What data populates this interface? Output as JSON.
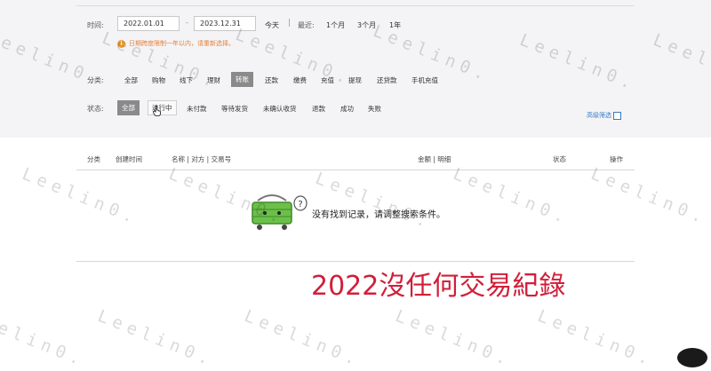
{
  "time_filter": {
    "label": "时间:",
    "start_date": "2022.01.01",
    "separator": "-",
    "end_date": "2023.12.31",
    "today": "今天",
    "divider": "|",
    "recent_label": "最近:",
    "ranges": [
      "1个月",
      "3个月",
      "1年"
    ],
    "warning": "日期跨度限制一年以内，请重新选择。"
  },
  "category_filter": {
    "label": "分类:",
    "options": [
      "全部",
      "购物",
      "线下",
      "理财",
      "转账",
      "还款",
      "缴费",
      "充值",
      "提现",
      "还贷款",
      "手机充值"
    ],
    "selected": "转账"
  },
  "status_filter": {
    "label": "状态:",
    "options": [
      "全部",
      "进行中",
      "未付款",
      "等待发货",
      "未确认收货",
      "退款",
      "成功",
      "失败"
    ],
    "selected": "全部",
    "hovered": "进行中"
  },
  "advanced_filter": {
    "label": "高级筛选"
  },
  "table": {
    "headers": {
      "category": "分类",
      "created": "创建时间",
      "name": "名称 | 对方 | 交易号",
      "amount": "金额 | 明细",
      "status": "状态",
      "action": "操作"
    },
    "empty_message": "没有找到记录，请调整搜索条件。"
  },
  "overlay_caption": "2022沒任何交易紀錄",
  "watermark": "Leelin0.",
  "colors": {
    "overlay": "#d11f3a",
    "warning": "#e5813a",
    "link": "#3a7ac4",
    "selected_chip": "#8a8a8a"
  }
}
